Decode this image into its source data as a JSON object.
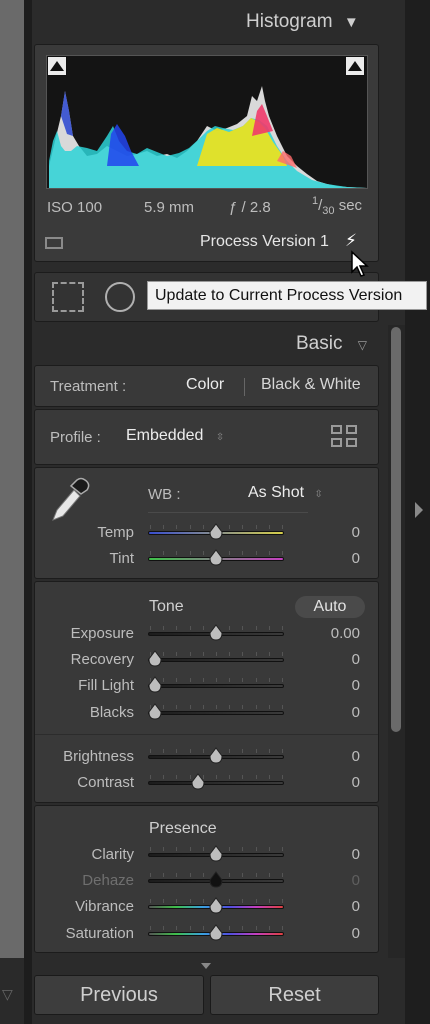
{
  "histogram": {
    "title": "Histogram",
    "collapse_glyph": "▼",
    "iso": "ISO 100",
    "focal": "5.9 mm",
    "aperture": "ƒ / 2.8",
    "shutter_num": "1",
    "shutter_den": "30",
    "shutter_unit": "sec",
    "process_version": "Process Version 1",
    "tooltip": "Update to Current Process Version"
  },
  "basic": {
    "title": "Basic",
    "treatment_label": "Treatment :",
    "treatment_color": "Color",
    "treatment_bw": "Black & White",
    "profile_label": "Profile :",
    "profile_value": "Embedded",
    "wb_label": "WB :",
    "wb_value": "As Shot",
    "tone_title": "Tone",
    "auto_label": "Auto",
    "presence_title": "Presence",
    "sliders": [
      {
        "label": "Temp",
        "value": "0",
        "level": 0.5
      },
      {
        "label": "Tint",
        "value": "0",
        "level": 0.5
      },
      {
        "label": "Exposure",
        "value": "0.00",
        "level": 0.5
      },
      {
        "label": "Recovery",
        "value": "0",
        "level": 0.0
      },
      {
        "label": "Fill Light",
        "value": "0",
        "level": 0.0
      },
      {
        "label": "Blacks",
        "value": "0",
        "level": 0.0
      },
      {
        "label": "Brightness",
        "value": "0",
        "level": 0.5
      },
      {
        "label": "Contrast",
        "value": "0",
        "level": 0.35
      },
      {
        "label": "Clarity",
        "value": "0",
        "level": 0.5
      },
      {
        "label": "Dehaze",
        "value": "0",
        "level": 0.5
      },
      {
        "label": "Vibrance",
        "value": "0",
        "level": 0.5
      },
      {
        "label": "Saturation",
        "value": "0",
        "level": 0.5
      }
    ]
  },
  "footer": {
    "previous_label": "Previous",
    "reset_label": "Reset"
  },
  "colors": {
    "panel_bg": "#393939",
    "app_bg": "#2b2b2b",
    "temp_start": "#3a4fd0",
    "temp_end": "#d6cf4a",
    "tint_start": "#3fc24a",
    "tint_end": "#c43fbf"
  }
}
